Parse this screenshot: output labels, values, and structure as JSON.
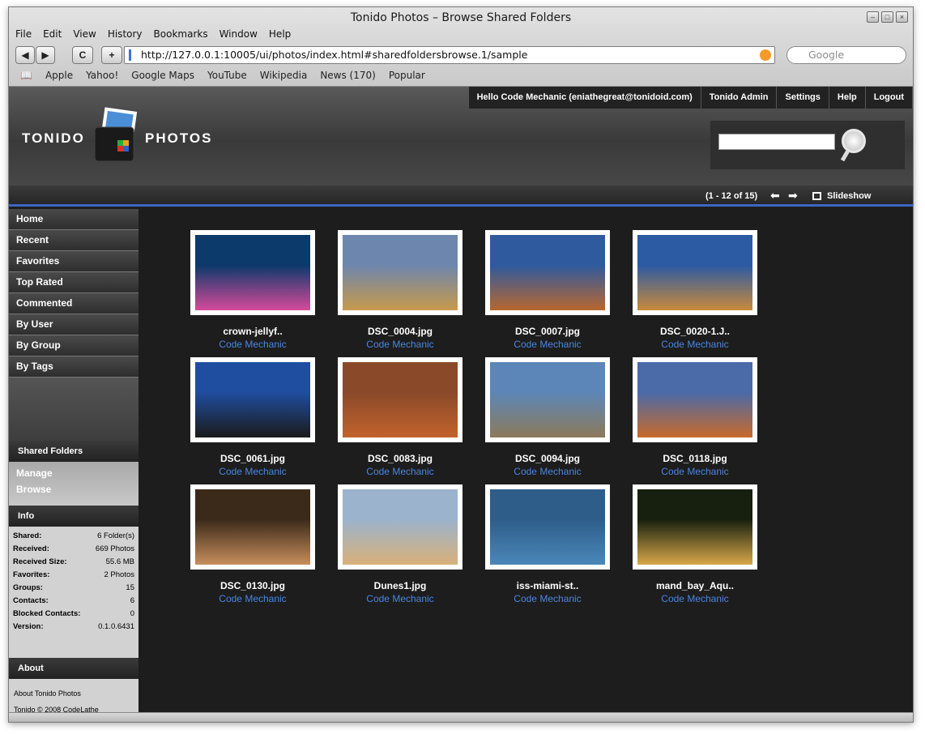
{
  "window": {
    "title": "Tonido Photos – Browse Shared Folders",
    "controls": [
      "minimize-button",
      "maximize-button",
      "close-button"
    ]
  },
  "menu": [
    "File",
    "Edit",
    "View",
    "History",
    "Bookmarks",
    "Window",
    "Help"
  ],
  "navigation": {
    "back_label": "◀",
    "forward_label": "▶",
    "reload_label": "C",
    "add_label": "+",
    "url": "http://127.0.0.1:10005/ui/photos/index.html#sharedfoldersbrowse.1/sample",
    "search_placeholder": "Google"
  },
  "bookmarks": [
    "Apple",
    "Yahoo!",
    "Google Maps",
    "YouTube",
    "Wikipedia",
    "News (170)",
    "Popular"
  ],
  "header": {
    "greeting": "Hello Code Mechanic (eniathegreat@tonidoid.com)",
    "nav": [
      "Tonido Admin",
      "Settings",
      "Help",
      "Logout"
    ],
    "logo_left": "TONIDO",
    "logo_right": "PHOTOS"
  },
  "pager": {
    "range": "(1 - 12 of 15)",
    "slideshow": "Slideshow"
  },
  "sidebar": {
    "items": [
      "Home",
      "Recent",
      "Favorites",
      "Top Rated",
      "Commented",
      "By User",
      "By Group",
      "By Tags"
    ],
    "shared_folders": {
      "title": "Shared Folders",
      "items": [
        "Manage",
        "Browse"
      ]
    },
    "info": {
      "title": "Info",
      "rows": [
        {
          "k": "Shared:",
          "v": "6 Folder(s)"
        },
        {
          "k": "Received:",
          "v": "669 Photos"
        },
        {
          "k": "Received Size:",
          "v": "55.6 MB"
        },
        {
          "k": "Favorites:",
          "v": "2 Photos"
        },
        {
          "k": "Groups:",
          "v": "15"
        },
        {
          "k": "Contacts:",
          "v": "6"
        },
        {
          "k": "Blocked Contacts:",
          "v": "0"
        },
        {
          "k": "Version:",
          "v": "0.1.0.6431"
        }
      ]
    },
    "about": {
      "title": "About",
      "lines": [
        "About Tonido Photos",
        "Tonido © 2008 CodeLathe"
      ]
    }
  },
  "photos": [
    {
      "name": "crown-jellyf..",
      "owner": "Code Mechanic",
      "colors": [
        "#0b3a6b",
        "#d64a9a"
      ]
    },
    {
      "name": "DSC_0004.jpg",
      "owner": "Code Mechanic",
      "colors": [
        "#6d86ad",
        "#c79a4b"
      ]
    },
    {
      "name": "DSC_0007.jpg",
      "owner": "Code Mechanic",
      "colors": [
        "#2f5a9e",
        "#b8672f"
      ]
    },
    {
      "name": "DSC_0020-1.J..",
      "owner": "Code Mechanic",
      "colors": [
        "#2c5aa3",
        "#c98a3c"
      ]
    },
    {
      "name": "DSC_0061.jpg",
      "owner": "Code Mechanic",
      "colors": [
        "#1f4d9f",
        "#1b1b1b"
      ]
    },
    {
      "name": "DSC_0083.jpg",
      "owner": "Code Mechanic",
      "colors": [
        "#8a4a2a",
        "#c2622c"
      ]
    },
    {
      "name": "DSC_0094.jpg",
      "owner": "Code Mechanic",
      "colors": [
        "#5c86b8",
        "#8c7a5a"
      ]
    },
    {
      "name": "DSC_0118.jpg",
      "owner": "Code Mechanic",
      "colors": [
        "#4a6aa8",
        "#c86a2a"
      ]
    },
    {
      "name": "DSC_0130.jpg",
      "owner": "Code Mechanic",
      "colors": [
        "#3b2a1a",
        "#c78e5c"
      ]
    },
    {
      "name": "Dunes1.jpg",
      "owner": "Code Mechanic",
      "colors": [
        "#9bb3cc",
        "#d8b07a"
      ]
    },
    {
      "name": "iss-miami-st..",
      "owner": "Code Mechanic",
      "colors": [
        "#2e5d8a",
        "#4a88b9"
      ]
    },
    {
      "name": "mand_bay_Aqu..",
      "owner": "Code Mechanic",
      "colors": [
        "#17200f",
        "#d8a84a"
      ]
    }
  ]
}
